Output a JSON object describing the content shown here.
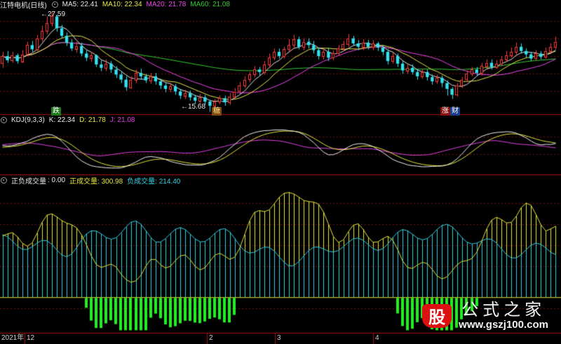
{
  "colors": {
    "background": "#000000",
    "up": "#ff3b3b",
    "down": "#33e1f0",
    "ma5": "#e6e6e6",
    "ma10": "#e8e84a",
    "ma20": "#ee44ee",
    "ma60": "#33cc33",
    "kdj_k": "#f0f0f0",
    "kdj_d": "#e6e63c",
    "kdj_j": "#e040e0",
    "pos_line": "#e6e63c",
    "neg_line": "#33d0e0",
    "green_bar": "#22ee22",
    "grid": "#7a1010",
    "panel_border": "#aa1111",
    "axis_text": "#d0d0d0"
  },
  "main_panel": {
    "title": "江特电机(日线)",
    "gear_icon": "gear-icon",
    "indicators": [
      {
        "label": "MA5: 22.41",
        "color": "#e6e6e6"
      },
      {
        "label": "MA10: 22.34",
        "color": "#e8e84a"
      },
      {
        "label": "MA20: 21.78",
        "color": "#ee44ee"
      },
      {
        "label": "MA60: 21.08",
        "color": "#33cc33"
      }
    ],
    "high_label": "27.59",
    "low_label": "15.68",
    "tags": [
      {
        "text": "跌",
        "bg": "#1a7a1a",
        "color": "#ffffff"
      },
      {
        "text": "糖",
        "bg": "#7a4a10",
        "color": "#ffdd88"
      },
      {
        "text": "涨",
        "bg": "#8a1010",
        "color": "#ffffff"
      },
      {
        "text": "财",
        "bg": "#1a3a8a",
        "color": "#ffffff"
      }
    ]
  },
  "kdj_panel": {
    "title": "KDJ(9,3,3)",
    "indicators": [
      {
        "label": "K: 22.34",
        "color": "#f0f0f0"
      },
      {
        "label": "D: 21.78",
        "color": "#e6e63c"
      },
      {
        "label": "J: 21.08",
        "color": "#e040e0"
      }
    ]
  },
  "cross_panel": {
    "title": "正负成交量",
    "indicators": [
      {
        "label": ": 0.00",
        "color": "#e6e6e6"
      },
      {
        "label": "正成交量: 300.98",
        "color": "#e6e63c"
      },
      {
        "label": "负成交量: 214.40",
        "color": "#33d0e0"
      }
    ]
  },
  "time_axis": {
    "labels": [
      "2021年",
      "12",
      "2",
      "3",
      "4"
    ]
  },
  "watermark": {
    "logo": "股",
    "title": "公式之家",
    "url": "www.gszj100.com"
  },
  "chart_data": {
    "type": "candlestick",
    "price_range": [
      15.68,
      27.59
    ],
    "candles": [
      [
        21.5,
        22.3,
        20.9,
        22.8
      ],
      [
        22.3,
        21.8,
        21.5,
        22.9
      ],
      [
        21.8,
        22.4,
        21.5,
        22.8
      ],
      [
        22.4,
        21.7,
        21.4,
        22.6
      ],
      [
        21.7,
        22.5,
        21.5,
        23.0
      ],
      [
        22.5,
        23.6,
        22.3,
        24.0
      ],
      [
        23.6,
        23.1,
        22.8,
        24.1
      ],
      [
        23.1,
        24.4,
        22.9,
        24.8
      ],
      [
        24.4,
        25.3,
        24.0,
        25.9
      ],
      [
        25.3,
        26.2,
        24.9,
        27.0
      ],
      [
        26.2,
        27.0,
        25.8,
        27.59
      ],
      [
        27.0,
        25.6,
        25.2,
        27.2
      ],
      [
        25.6,
        24.7,
        24.4,
        26.0
      ],
      [
        24.7,
        23.9,
        23.5,
        25.1
      ],
      [
        23.9,
        23.2,
        22.9,
        24.3
      ],
      [
        23.2,
        23.5,
        22.7,
        24.0
      ],
      [
        23.5,
        22.6,
        22.3,
        23.9
      ],
      [
        22.6,
        22.1,
        21.7,
        23.0
      ],
      [
        22.1,
        22.4,
        21.6,
        22.8
      ],
      [
        22.4,
        21.3,
        21.0,
        22.5
      ],
      [
        21.3,
        20.9,
        20.5,
        21.8
      ],
      [
        20.9,
        21.4,
        20.5,
        21.9
      ],
      [
        21.4,
        20.7,
        20.3,
        21.7
      ],
      [
        20.7,
        20.1,
        19.7,
        21.1
      ],
      [
        20.1,
        19.5,
        19.1,
        20.5
      ],
      [
        19.5,
        18.6,
        18.2,
        19.9
      ],
      [
        18.6,
        19.5,
        18.4,
        19.9
      ],
      [
        19.5,
        20.3,
        19.1,
        20.7
      ],
      [
        20.3,
        19.9,
        19.5,
        20.8
      ],
      [
        19.9,
        19.4,
        19.1,
        20.2
      ],
      [
        19.4,
        19.9,
        19.0,
        20.3
      ],
      [
        19.9,
        19.3,
        18.9,
        20.3
      ],
      [
        19.3,
        18.8,
        18.4,
        19.6
      ],
      [
        18.8,
        18.4,
        18.0,
        19.1
      ],
      [
        18.4,
        18.7,
        18.0,
        19.1
      ],
      [
        18.7,
        18.1,
        17.7,
        19.0
      ],
      [
        18.1,
        17.6,
        17.2,
        18.4
      ],
      [
        17.6,
        17.9,
        17.2,
        18.3
      ],
      [
        17.9,
        17.4,
        17.0,
        18.2
      ],
      [
        17.4,
        17.0,
        16.6,
        17.7
      ],
      [
        17.0,
        17.4,
        16.7,
        17.8
      ],
      [
        17.4,
        16.9,
        16.5,
        17.7
      ],
      [
        16.9,
        16.4,
        15.68,
        17.1
      ],
      [
        16.4,
        16.9,
        16.0,
        17.2
      ],
      [
        16.9,
        17.3,
        16.6,
        17.6
      ],
      [
        17.3,
        16.8,
        16.4,
        17.6
      ],
      [
        16.8,
        17.5,
        16.5,
        17.9
      ],
      [
        17.5,
        18.1,
        17.2,
        18.5
      ],
      [
        18.1,
        18.8,
        17.8,
        19.2
      ],
      [
        18.8,
        19.5,
        18.5,
        19.9
      ],
      [
        19.5,
        20.1,
        19.2,
        20.4
      ],
      [
        20.1,
        20.7,
        19.8,
        21.1
      ],
      [
        20.7,
        20.4,
        20.0,
        21.0
      ],
      [
        20.4,
        21.3,
        20.1,
        21.7
      ],
      [
        21.3,
        22.1,
        21.0,
        22.6
      ],
      [
        22.1,
        22.8,
        21.8,
        23.2
      ],
      [
        22.8,
        22.3,
        22.0,
        23.2
      ],
      [
        22.3,
        23.1,
        22.0,
        23.4
      ],
      [
        23.1,
        23.6,
        22.7,
        24.3
      ],
      [
        23.6,
        24.3,
        23.2,
        24.8
      ],
      [
        24.3,
        23.4,
        23.1,
        24.6
      ],
      [
        23.4,
        24.0,
        23.0,
        24.4
      ],
      [
        24.0,
        23.6,
        23.2,
        24.4
      ],
      [
        23.6,
        23.0,
        22.6,
        24.1
      ],
      [
        23.0,
        22.3,
        21.9,
        23.3
      ],
      [
        22.3,
        22.8,
        21.9,
        23.2
      ],
      [
        22.8,
        22.1,
        21.7,
        23.3
      ],
      [
        22.1,
        22.6,
        21.8,
        23.0
      ],
      [
        22.6,
        23.2,
        22.3,
        23.6
      ],
      [
        23.2,
        23.7,
        22.9,
        24.1
      ],
      [
        23.7,
        24.4,
        23.4,
        24.9
      ],
      [
        24.4,
        23.8,
        23.5,
        24.7
      ],
      [
        23.8,
        23.4,
        23.0,
        24.2
      ],
      [
        23.4,
        23.9,
        23.0,
        24.3
      ],
      [
        23.9,
        23.4,
        23.1,
        24.2
      ],
      [
        23.4,
        23.8,
        23.0,
        24.2
      ],
      [
        23.8,
        23.3,
        22.9,
        24.0
      ],
      [
        23.3,
        22.8,
        22.4,
        23.6
      ],
      [
        22.8,
        21.7,
        21.3,
        23.1
      ],
      [
        21.7,
        22.3,
        21.4,
        22.7
      ],
      [
        22.3,
        21.4,
        21.0,
        22.6
      ],
      [
        21.4,
        20.6,
        20.2,
        21.7
      ],
      [
        20.6,
        20.9,
        20.2,
        21.3
      ],
      [
        20.9,
        20.4,
        20.1,
        21.3
      ],
      [
        20.4,
        19.9,
        19.5,
        20.8
      ],
      [
        19.9,
        20.4,
        19.6,
        20.8
      ],
      [
        20.4,
        19.8,
        19.4,
        20.7
      ],
      [
        19.8,
        19.3,
        18.9,
        20.1
      ],
      [
        19.3,
        19.7,
        19.0,
        20.1
      ],
      [
        19.7,
        19.1,
        18.6,
        20.0
      ],
      [
        19.1,
        18.4,
        17.6,
        19.4
      ],
      [
        18.4,
        17.7,
        17.2,
        18.6
      ],
      [
        17.7,
        18.8,
        17.5,
        19.1
      ],
      [
        18.8,
        19.5,
        18.5,
        19.8
      ],
      [
        19.5,
        20.2,
        19.2,
        20.6
      ],
      [
        20.2,
        20.7,
        19.9,
        21.0
      ],
      [
        20.7,
        20.3,
        20.0,
        21.0
      ],
      [
        20.3,
        21.1,
        20.0,
        21.5
      ],
      [
        21.1,
        21.5,
        20.8,
        21.9
      ],
      [
        21.5,
        21.0,
        20.7,
        21.9
      ],
      [
        21.0,
        21.4,
        20.8,
        21.8
      ],
      [
        21.4,
        21.9,
        21.1,
        22.3
      ],
      [
        21.9,
        22.4,
        21.6,
        22.9
      ],
      [
        22.4,
        22.8,
        22.1,
        23.3
      ],
      [
        22.8,
        23.4,
        22.5,
        23.9
      ],
      [
        23.4,
        22.9,
        22.6,
        23.8
      ],
      [
        22.9,
        22.5,
        22.1,
        23.2
      ],
      [
        22.5,
        22.0,
        21.7,
        22.8
      ],
      [
        22.0,
        22.6,
        21.8,
        23.0
      ],
      [
        22.6,
        22.2,
        21.9,
        22.9
      ],
      [
        22.2,
        22.9,
        22.0,
        23.3
      ],
      [
        22.9,
        23.4,
        22.6,
        23.8
      ],
      [
        23.4,
        24.0,
        23.1,
        24.6
      ]
    ],
    "kdj_range": [
      0,
      100
    ],
    "volume_range": [
      -140,
      450
    ]
  }
}
